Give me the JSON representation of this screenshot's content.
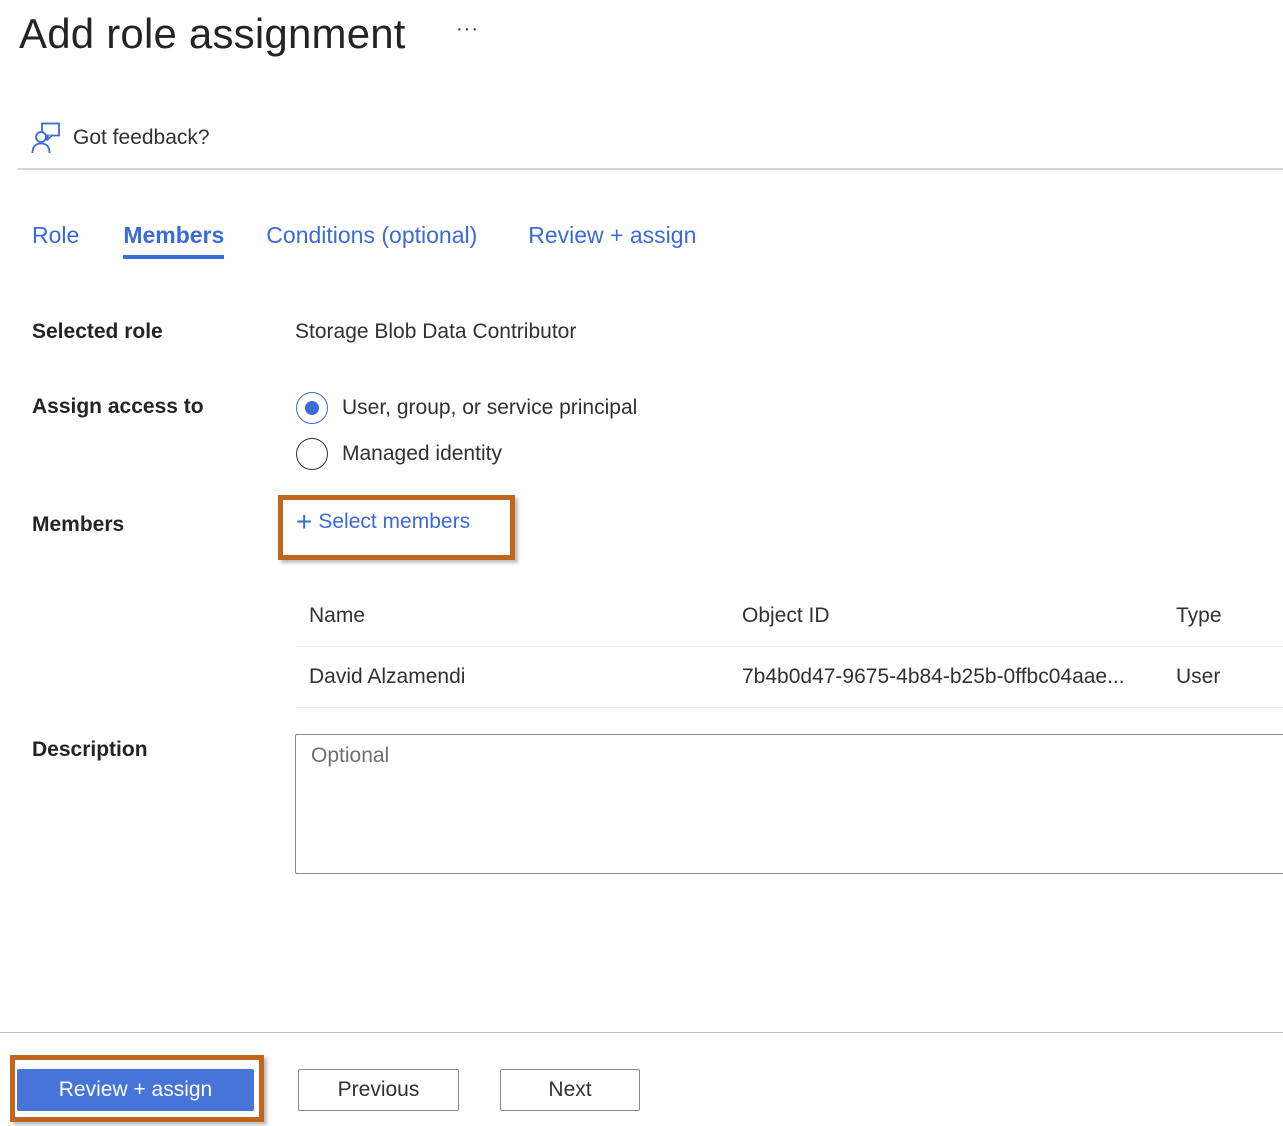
{
  "header": {
    "title": "Add role assignment",
    "more_label": "···"
  },
  "feedback": {
    "icon": "feedback-person-icon",
    "label": "Got feedback?"
  },
  "tabs": [
    {
      "label": "Role",
      "active": false
    },
    {
      "label": "Members",
      "active": true
    },
    {
      "label": "Conditions (optional)",
      "active": false
    },
    {
      "label": "Review + assign",
      "active": false
    }
  ],
  "form": {
    "selected_role": {
      "label": "Selected role",
      "value": "Storage Blob Data Contributor"
    },
    "assign_access": {
      "label": "Assign access to",
      "options": [
        {
          "label": "User, group, or service principal",
          "checked": true
        },
        {
          "label": "Managed identity",
          "checked": false
        }
      ]
    },
    "members": {
      "label": "Members",
      "select_label": "Select members",
      "select_icon": "plus-icon",
      "table": {
        "columns": [
          "Name",
          "Object ID",
          "Type"
        ],
        "rows": [
          {
            "name": "David Alzamendi",
            "object_id": "7b4b0d47-9675-4b84-b25b-0ffbc04aae...",
            "type": "User"
          }
        ]
      }
    },
    "description": {
      "label": "Description",
      "placeholder": "Optional",
      "value": ""
    }
  },
  "footer": {
    "review_assign_label": "Review + assign",
    "previous_label": "Previous",
    "next_label": "Next"
  },
  "colors": {
    "accent": "#3a6bd8",
    "primary_button": "#4674d7",
    "highlight_box": "#c0661f"
  }
}
